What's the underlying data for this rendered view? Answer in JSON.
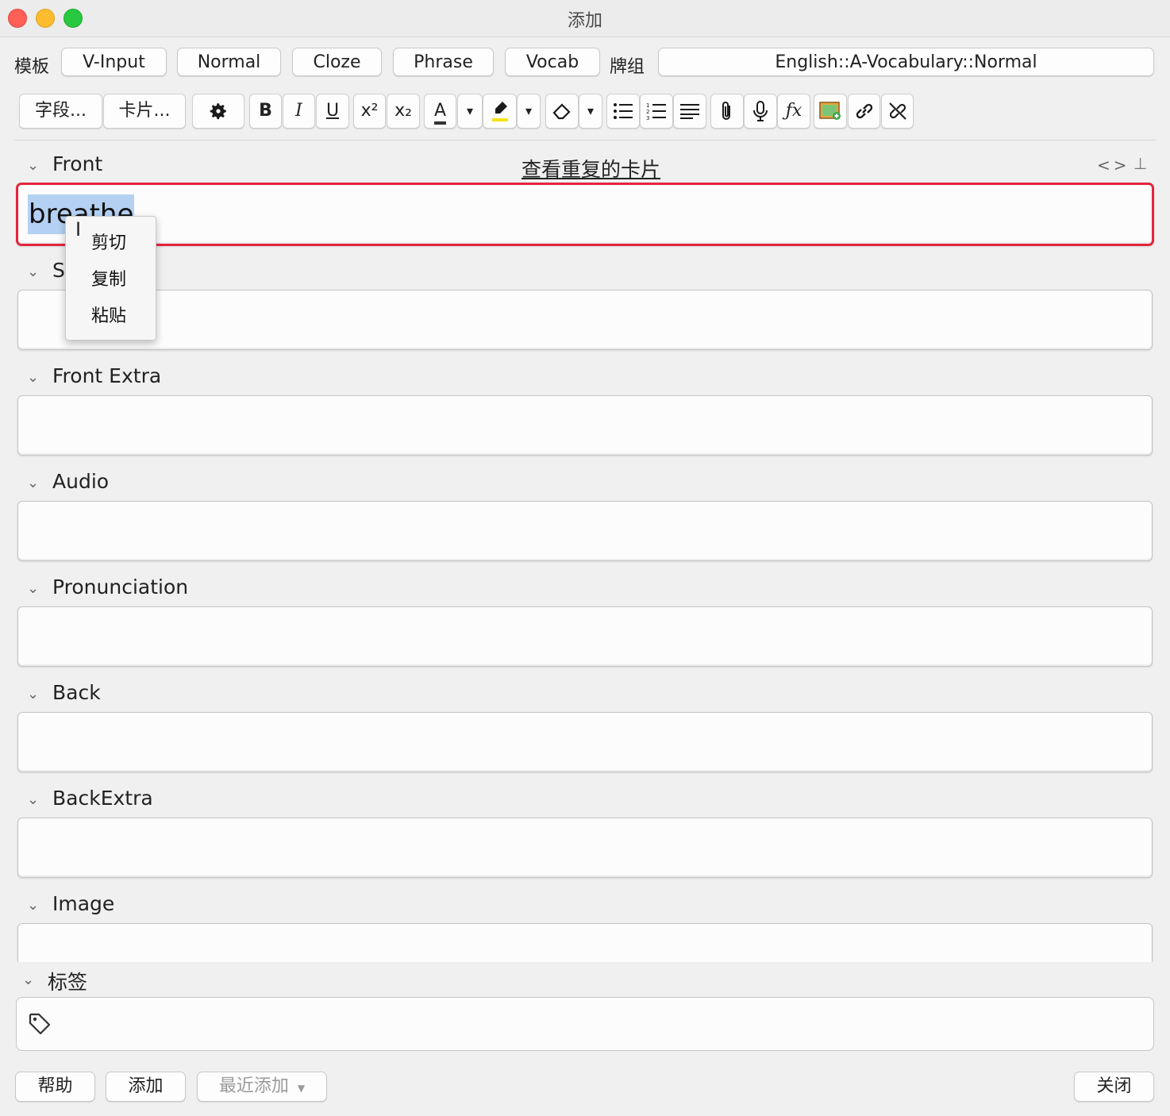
{
  "window": {
    "title": "添加"
  },
  "model_row": {
    "model_label": "模板",
    "models": [
      "V-Input",
      "Normal",
      "Cloze",
      "Phrase",
      "Vocab"
    ],
    "deck_label": "牌组",
    "deck_value": "English::A-Vocabulary::Normal"
  },
  "toolbar": {
    "fields_button": "字段...",
    "cards_button": "卡片...",
    "buttons": [
      {
        "name": "gear-icon",
        "glyph": "⚙"
      },
      {
        "name": "bold-icon",
        "glyph": "B"
      },
      {
        "name": "italic-icon",
        "glyph": "I"
      },
      {
        "name": "underline-icon",
        "glyph": "U"
      },
      {
        "name": "superscript-icon",
        "glyph": "x²"
      },
      {
        "name": "subscript-icon",
        "glyph": "x₂"
      },
      {
        "name": "text-color-icon",
        "glyph": "A"
      },
      {
        "name": "text-color-dropdown-icon",
        "glyph": "⌄"
      },
      {
        "name": "highlight-icon",
        "glyph": "✎"
      },
      {
        "name": "highlight-dropdown-icon",
        "glyph": "⌄"
      },
      {
        "name": "eraser-icon",
        "glyph": "◇"
      },
      {
        "name": "eraser-dropdown-icon",
        "glyph": "⌄"
      },
      {
        "name": "bullet-list-icon",
        "glyph": "☰"
      },
      {
        "name": "numbered-list-icon",
        "glyph": "☷"
      },
      {
        "name": "align-icon",
        "glyph": "≡"
      },
      {
        "name": "attachment-icon",
        "glyph": "📎"
      },
      {
        "name": "microphone-icon",
        "glyph": "🎙"
      },
      {
        "name": "formula-icon",
        "glyph": "ƒx"
      },
      {
        "name": "image-occlusion-icon",
        "glyph": "▣"
      },
      {
        "name": "link-icon",
        "glyph": "🔗"
      },
      {
        "name": "unlink-icon",
        "glyph": "⛓"
      }
    ]
  },
  "fields": [
    {
      "label": "Front",
      "value": "breathe"
    },
    {
      "label": "S      b",
      "value": ""
    },
    {
      "label": "Front Extra",
      "value": ""
    },
    {
      "label": "Audio",
      "value": ""
    },
    {
      "label": "Pronunciation",
      "value": ""
    },
    {
      "label": "Back",
      "value": ""
    },
    {
      "label": "BackExtra",
      "value": ""
    },
    {
      "label": "Image",
      "value": ""
    }
  ],
  "duplicate_link": "查看重复的卡片",
  "context_menu": [
    "剪切",
    "复制",
    "粘贴"
  ],
  "tags": {
    "label": "标签"
  },
  "bottom": {
    "help": "帮助",
    "add": "添加",
    "history": "最近添加",
    "close": "关闭"
  },
  "colors": {
    "active_border": "#e4253c",
    "selection": "#b4d1f3"
  }
}
